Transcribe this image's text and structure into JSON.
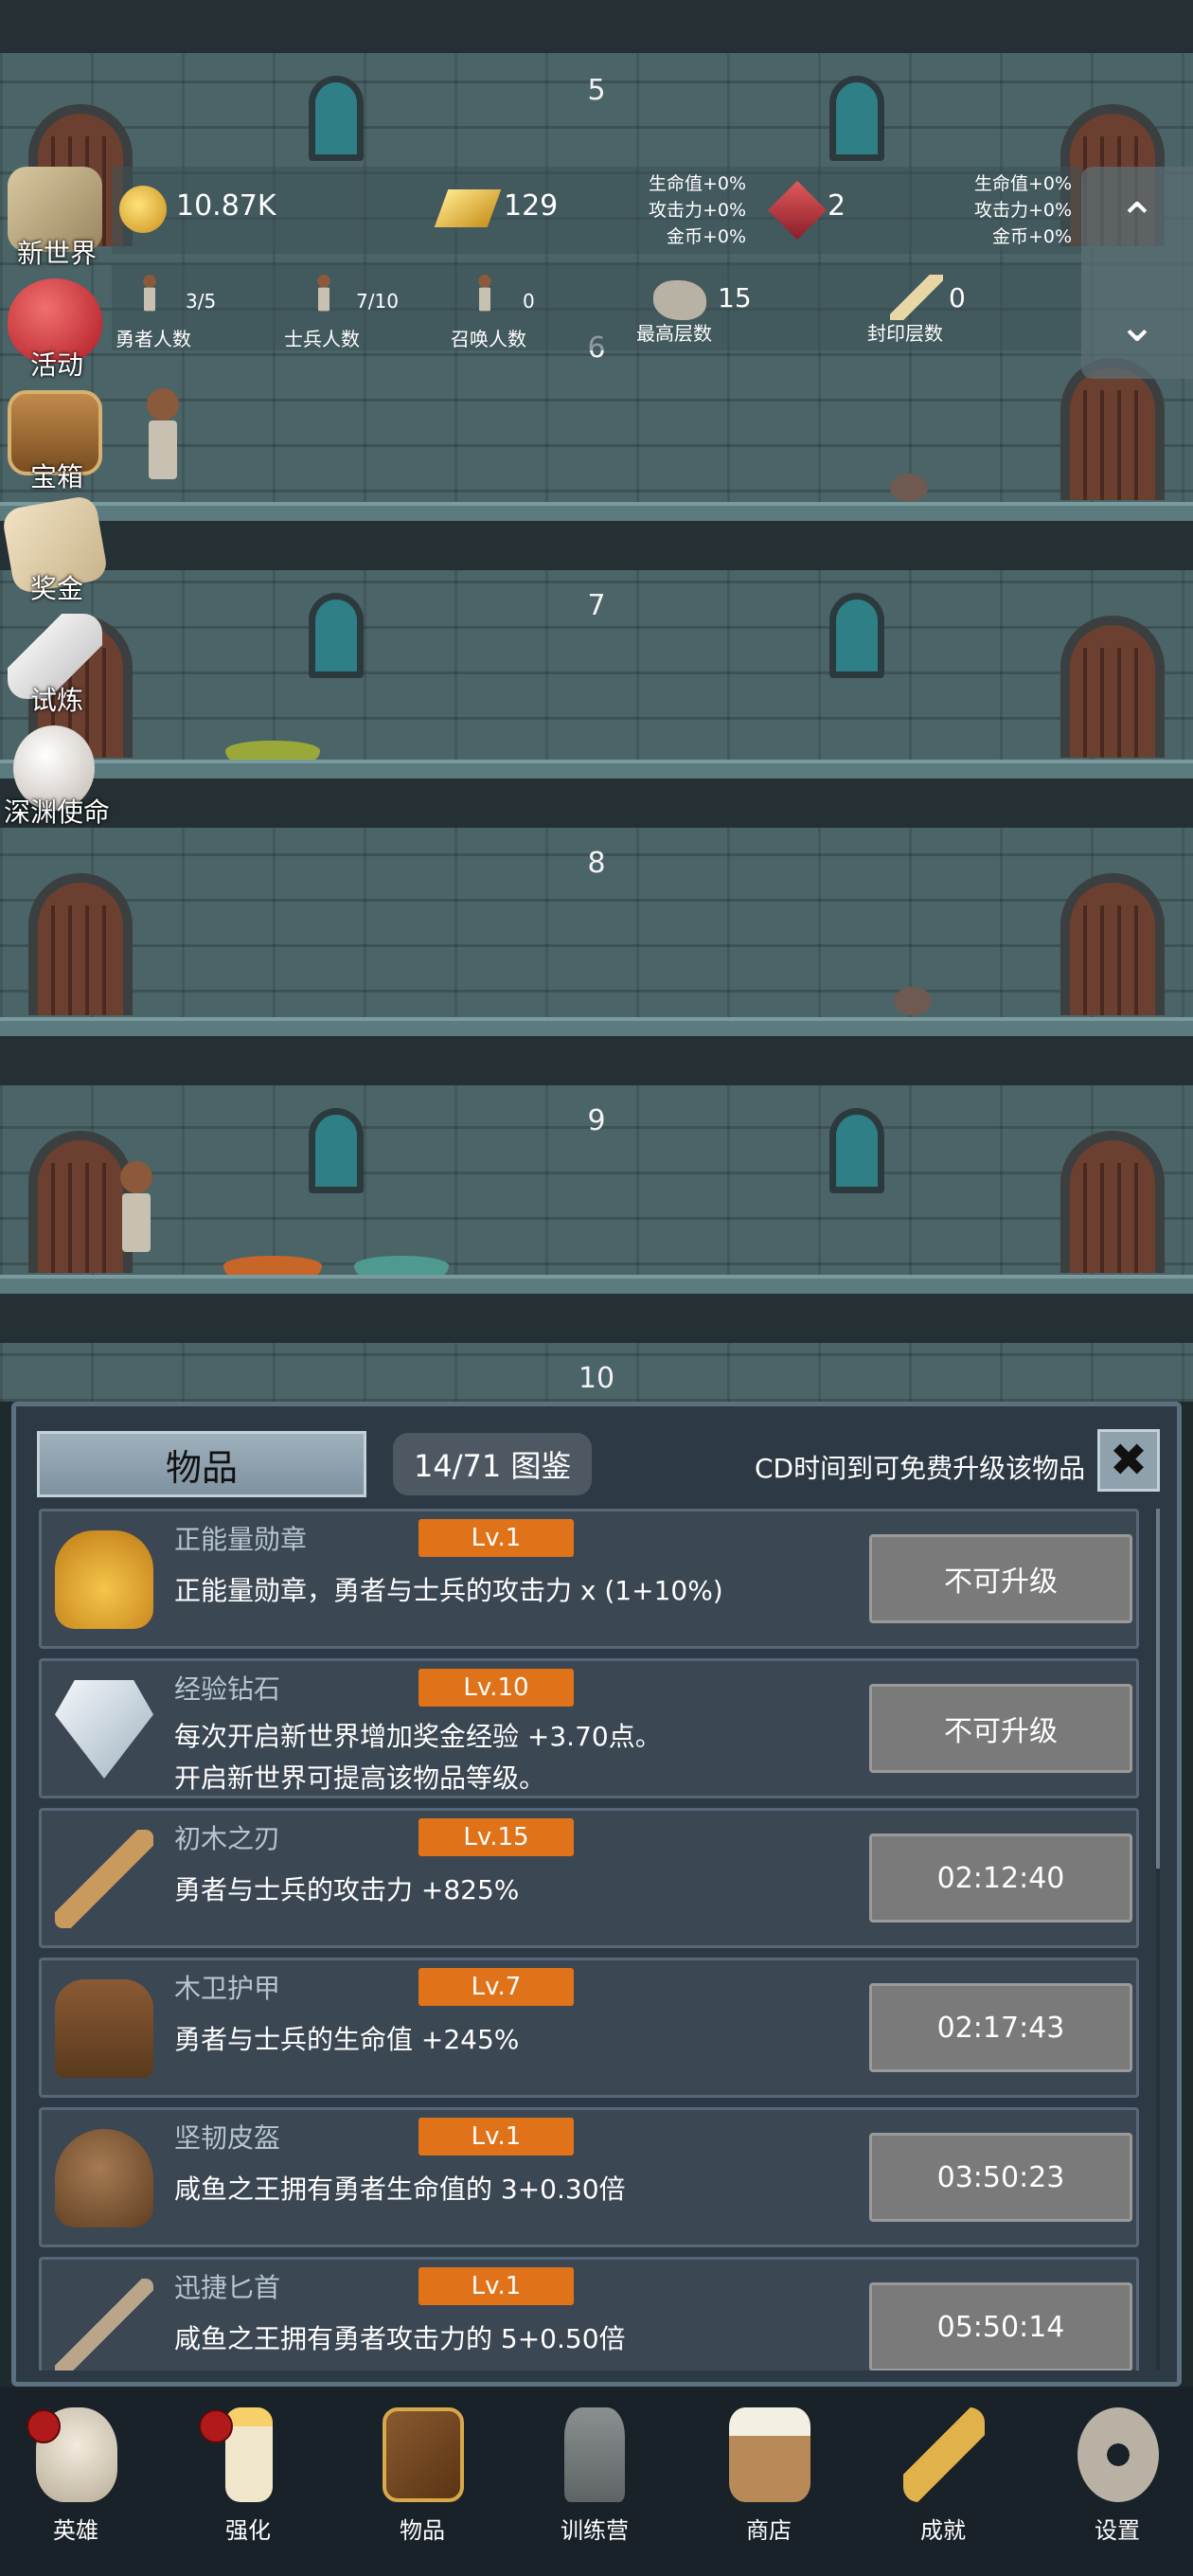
{
  "floors": [
    "5",
    "6",
    "7",
    "8",
    "9",
    "10"
  ],
  "hud": {
    "gold": "10.87K",
    "bars": "129",
    "gems": "2",
    "bonus_left": [
      "生命值+0%",
      "攻击力+0%",
      "金币+0%"
    ],
    "bonus_right": [
      "生命值+0%",
      "攻击力+0%",
      "金币+0%"
    ],
    "heroes_count": "3/5",
    "heroes_label": "勇者人数",
    "soldiers_count": "7/10",
    "soldiers_label": "士兵人数",
    "summon_count": "0",
    "summon_label": "召唤人数",
    "max_floor_count": "15",
    "max_floor_label": "最高层数",
    "sealed_count": "0",
    "sealed_label": "封印层数",
    "up_icon": "chevron-up-icon",
    "down_icon": "chevron-down-icon"
  },
  "side_menu": [
    {
      "label": "新世界",
      "icon": "map-icon"
    },
    {
      "label": "活动",
      "icon": "heart-icon"
    },
    {
      "label": "宝箱",
      "icon": "chest-icon"
    },
    {
      "label": "奖金",
      "icon": "envelope-icon"
    },
    {
      "label": "试炼",
      "icon": "feather-icon"
    },
    {
      "label": "深渊使命",
      "icon": "pearl-icon"
    }
  ],
  "panel": {
    "title": "物品",
    "collection": "14/71 图鉴",
    "hint": "CD时间到可免费升级该物品",
    "close_icon": "close-icon"
  },
  "items": [
    {
      "name": "正能量勋章",
      "level": "Lv.1",
      "desc1": "正能量勋章，勇者与士兵的攻击力 x (1+10%)",
      "desc2": "",
      "button": "不可升级",
      "icon": "crown-icon"
    },
    {
      "name": "经验钻石",
      "level": "Lv.10",
      "desc1": "每次开启新世界增加奖金经验 +3.70点。",
      "desc2": "开启新世界可提高该物品等级。",
      "button": "不可升级",
      "icon": "diamond-icon"
    },
    {
      "name": "初木之刃",
      "level": "Lv.15",
      "desc1": "勇者与士兵的攻击力 +825%",
      "desc2": "",
      "button": "02:12:40",
      "icon": "wooden-sword-icon"
    },
    {
      "name": "木卫护甲",
      "level": "Lv.7",
      "desc1": "勇者与士兵的生命值 +245%",
      "desc2": "",
      "button": "02:17:43",
      "icon": "armor-icon"
    },
    {
      "name": "坚韧皮盔",
      "level": "Lv.1",
      "desc1": "咸鱼之王拥有勇者生命值的 3+0.30倍",
      "desc2": "",
      "button": "03:50:23",
      "icon": "leather-helmet-icon"
    },
    {
      "name": "迅捷匕首",
      "level": "Lv.1",
      "desc1": "咸鱼之王拥有勇者攻击力的 5+0.50倍",
      "desc2": "",
      "button": "05:50:14",
      "icon": "dagger-icon"
    }
  ],
  "nav": [
    {
      "label": "英雄",
      "icon": "skull-icon",
      "badge": true
    },
    {
      "label": "强化",
      "icon": "candle-icon",
      "badge": true
    },
    {
      "label": "物品",
      "icon": "book-icon",
      "badge": false
    },
    {
      "label": "训练营",
      "icon": "lantern-icon",
      "badge": false
    },
    {
      "label": "商店",
      "icon": "mug-icon",
      "badge": false
    },
    {
      "label": "成就",
      "icon": "key-icon",
      "badge": false
    },
    {
      "label": "设置",
      "icon": "gear-icon",
      "badge": false
    }
  ]
}
